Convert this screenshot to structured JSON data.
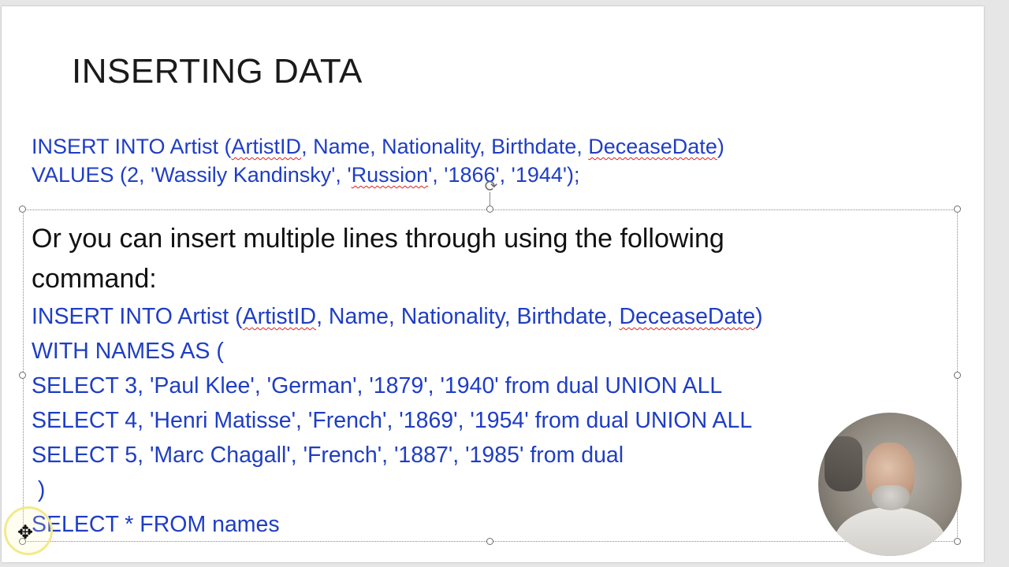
{
  "slide": {
    "title": "INSERTING DATA",
    "insert_single": {
      "line1": {
        "a": "INSERT INTO Artist (",
        "b": "ArtistID",
        "c": ", Name, Nationality, Birthdate, ",
        "d": "DeceaseDate",
        "e": ")"
      },
      "line2": {
        "a": "VALUES (2, 'Wassily Kandinsky', '",
        "b": "Russion",
        "c": "', '1866', '1944');"
      }
    },
    "prose": {
      "line1": "Or you can insert multiple lines through using the following",
      "line2": "command:"
    },
    "insert_multi": {
      "header": {
        "a": "INSERT INTO Artist (",
        "b": "ArtistID",
        "c": ", Name, Nationality, Birthdate, ",
        "d": "DeceaseDate",
        "e": ")"
      },
      "with": "WITH NAMES AS (",
      "rows": [
        "SELECT 3, 'Paul Klee', 'German', '1879', '1940' from dual UNION ALL",
        "SELECT 4, 'Henri Matisse', 'French', '1869', '1954' from dual UNION ALL",
        "SELECT 5, 'Marc Chagall', 'French', '1887', '1985' from dual"
      ],
      "close": " )",
      "final": "SELECT * FROM names"
    }
  },
  "colors": {
    "code": "#1f3ec4",
    "prose": "#111111",
    "spellcheck": "#e02020",
    "slide_bg": "#ffffff",
    "canvas_bg": "#e6e6e6"
  },
  "icons": {
    "rotate": "rotate-handle-icon",
    "cursor": "move-cursor-icon",
    "webcam": "presenter-webcam"
  }
}
